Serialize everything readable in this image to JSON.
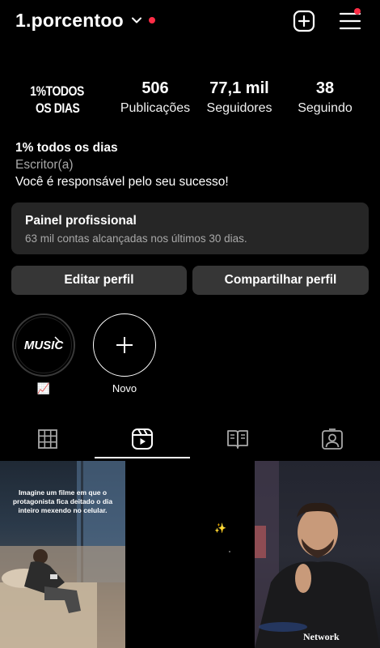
{
  "header": {
    "username": "1.porcentoo"
  },
  "profile": {
    "avatar_text_line1": "1%TODOS",
    "avatar_text_line2": "OS DIAS",
    "posts_count": "506",
    "posts_label": "Publicações",
    "followers_count": "77,1 mil",
    "followers_label": "Seguidores",
    "following_count": "38",
    "following_label": "Seguindo"
  },
  "bio": {
    "name": "1% todos os dias",
    "category": "Escritor(a)",
    "text": "Você é responsável pelo seu sucesso!"
  },
  "dashboard": {
    "title": "Painel profissional",
    "subtitle": "63 mil contas alcançadas nos últimos 30 dias."
  },
  "buttons": {
    "edit": "Editar perfil",
    "share": "Compartilhar perfil"
  },
  "highlights": [
    {
      "label": "📈",
      "cover_text": "MUSIC"
    },
    {
      "label": "Novo"
    }
  ],
  "tabs": [
    "grid",
    "reels",
    "guides",
    "tagged"
  ],
  "active_tab": "reels",
  "posts": [
    {
      "caption": "Imagine um filme em que o protagonista fica deitado o dia inteiro mexendo no celular."
    },
    {
      "caption": ""
    },
    {
      "watermark": "Network"
    }
  ],
  "colors": {
    "background": "#000000",
    "notification_dot": "#ff2d46",
    "card": "#262626",
    "button": "#363636",
    "secondary_text": "#a8a8a8"
  }
}
